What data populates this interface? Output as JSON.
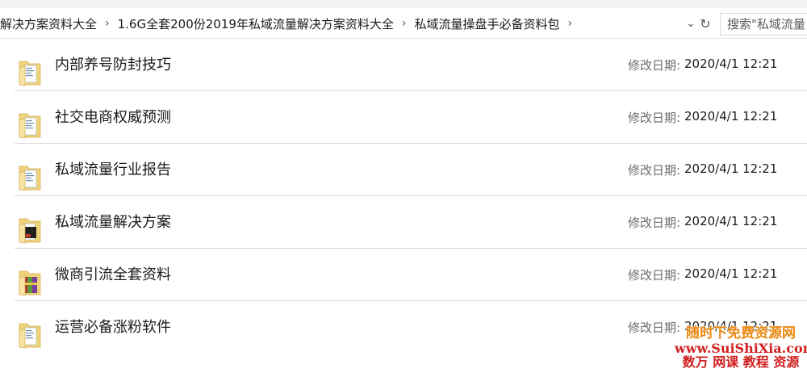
{
  "breadcrumb": {
    "items": [
      "解决方案资料大全",
      "1.6G全套200份2019年私域流量解决方案资料大全",
      "私域流量操盘手必备资料包"
    ],
    "separator": "›"
  },
  "address_controls": {
    "dropdown_glyph": "⌄",
    "refresh_glyph": "↻"
  },
  "search": {
    "placeholder": "搜索\"私域流量"
  },
  "files": [
    {
      "name": "内部养号防封技巧",
      "date_label": "修改日期:",
      "date": "2020/4/1 12:21",
      "icon": "folder-document-icon"
    },
    {
      "name": "社交电商权威预测",
      "date_label": "修改日期:",
      "date": "2020/4/1 12:21",
      "icon": "folder-document-icon"
    },
    {
      "name": "私域流量行业报告",
      "date_label": "修改日期:",
      "date": "2020/4/1 12:21",
      "icon": "folder-document-icon"
    },
    {
      "name": "私域流量解决方案",
      "date_label": "修改日期:",
      "date": "2020/4/1 12:21",
      "icon": "folder-dark-document-icon"
    },
    {
      "name": "微商引流全套资料",
      "date_label": "修改日期:",
      "date": "2020/4/1 12:21",
      "icon": "folder-archive-icon"
    },
    {
      "name": "运营必备涨粉软件",
      "date_label": "修改日期:",
      "date": "2020/4/1 12:21",
      "icon": "folder-document-icon"
    }
  ],
  "watermark": {
    "line1": "随时下免费资源网",
    "line2": "www.SuiShiXia.com",
    "line3": "数万 网课 教程 资源"
  },
  "colors": {
    "folder": "#f0d27a",
    "accent": "#0078d7",
    "watermark_orange": "#e98a12",
    "watermark_red": "#d12020"
  }
}
